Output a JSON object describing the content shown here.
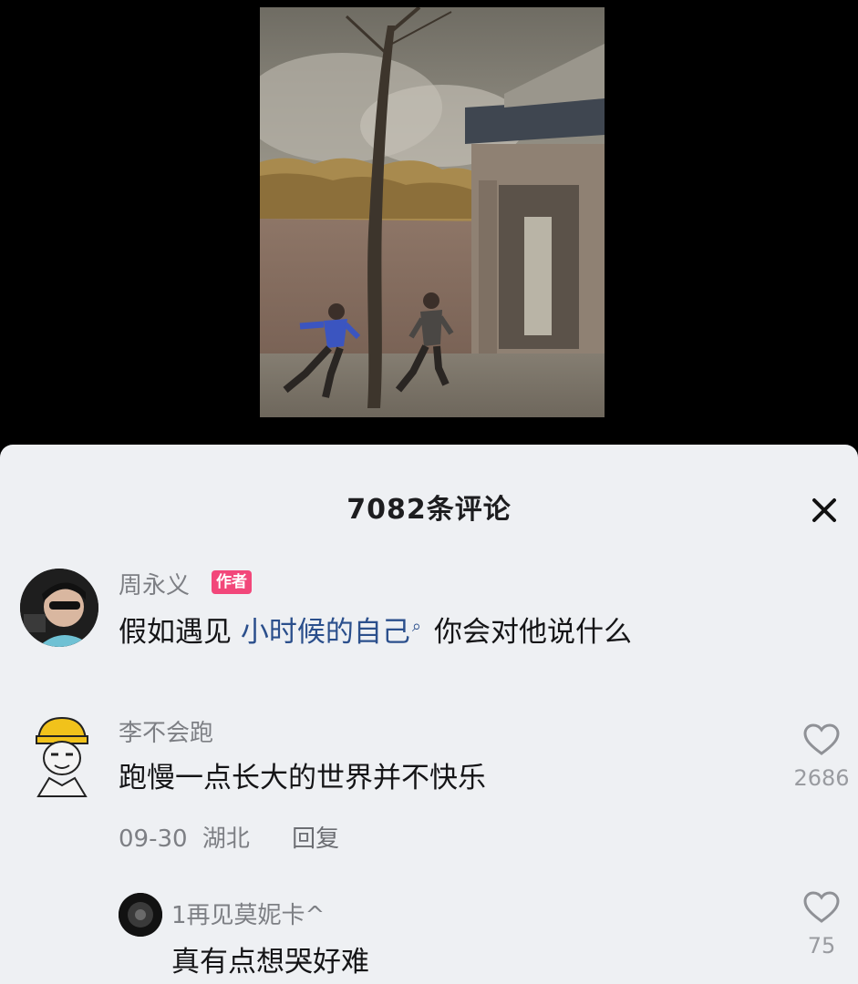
{
  "video": {
    "scene_description": ""
  },
  "comments_panel": {
    "title": "7082条评论",
    "close_icon": "close-icon"
  },
  "comments": [
    {
      "username": "周永义",
      "badge": "作者",
      "text_prefix": "假如遇见 ",
      "text_link": "小时候的自己",
      "text_suffix": "你会对他说什么",
      "search_icon": "search-icon"
    },
    {
      "username": "李不会跑",
      "text": "跑慢一点长大的世界并不快乐",
      "date": "09-30",
      "location": "湖北",
      "reply_label": "回复",
      "like_count": "2686",
      "like_icon": "heart-outline-icon"
    },
    {
      "username": "1再见莫妮卡^",
      "text": "真有点想哭好难",
      "like_count": "75",
      "like_icon": "heart-outline-icon"
    }
  ],
  "colors": {
    "panel_bg": "#eef0f3",
    "author_badge": "#f2477a",
    "link_text": "#2b4f8c",
    "meta_text": "#7d7f84"
  }
}
